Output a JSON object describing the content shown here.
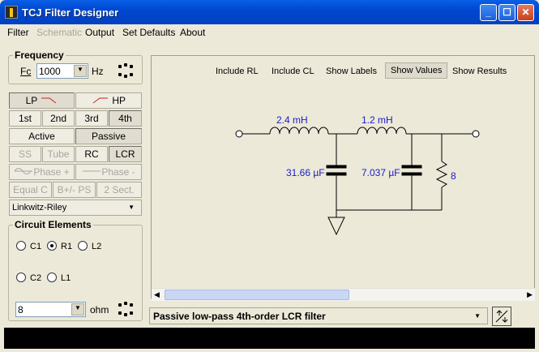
{
  "window": {
    "title": "TCJ Filter Designer"
  },
  "menu": [
    "Filter",
    "Schematic",
    "Output",
    "Set Defaults",
    "About"
  ],
  "frequency": {
    "label": "Frequency",
    "fc_label": "Fc",
    "value": "1000",
    "unit": "Hz"
  },
  "filter_buttons": {
    "lp": "LP",
    "hp": "HP",
    "order1": "1st",
    "order2": "2nd",
    "order3": "3rd",
    "order4": "4th",
    "active": "Active",
    "passive": "Passive",
    "ss": "SS",
    "tube": "Tube",
    "rc": "RC",
    "lcr": "LCR",
    "phase_plus": "Phase +",
    "phase_minus": "Phase -",
    "equal_c": "Equal C",
    "b_ps": "B+/- PS",
    "two_sect": "2 Sect."
  },
  "alignment": {
    "selected": "Linkwitz-Riley"
  },
  "elements": {
    "label": "Circuit Elements",
    "c1": "C1",
    "r1": "R1",
    "l2": "L2",
    "c2": "C2",
    "l1": "L1",
    "selected": "R1",
    "value": "8",
    "unit": "ohm"
  },
  "toolbar": {
    "include_rl": "Include RL",
    "include_cl": "Include CL",
    "show_labels": "Show Labels",
    "show_values": "Show Values",
    "show_results": "Show Results"
  },
  "schematic": {
    "l1_value": "2.4 mH",
    "l2_value": "1.2 mH",
    "c1_value": "31.66 µF",
    "c2_value": "7.037 µF",
    "r_value": "8",
    "value_color": "#1a1acc"
  },
  "description": {
    "selected": "Passive low-pass 4th-order LCR filter"
  }
}
